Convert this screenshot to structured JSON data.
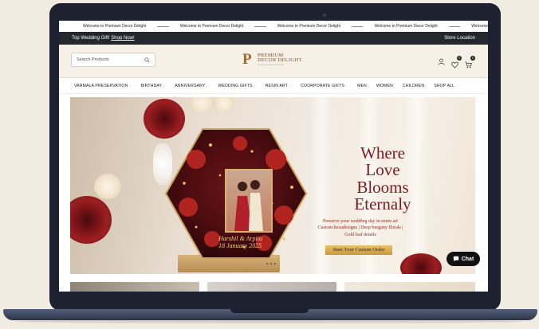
{
  "announcement": {
    "items": [
      "Welcome to Premium Decor Delight",
      "Welcome to Premium Decor Delight",
      "Welcome to Premium Decor Delight",
      "Welcome to Premium Decor Delight",
      "Welcome"
    ]
  },
  "topbar": {
    "promo_text": "Top Wedding Gift!",
    "promo_link": "Shop Now!",
    "store_location": "Store Location"
  },
  "header": {
    "search_placeholder": "Search Products",
    "logo_line1": "PREMIUM",
    "logo_line2": "DECOR DELIGHT",
    "logo_tagline": "Let The Love Blossom This Day",
    "wishlist_count": "0",
    "cart_count": "0"
  },
  "nav": {
    "items": [
      {
        "label": "VARMALA PRESERVATION",
        "dropdown": true
      },
      {
        "label": "BIRTHDAY",
        "dropdown": true
      },
      {
        "label": "ANNIVERSARY",
        "dropdown": true
      },
      {
        "label": "WEDDING GIFTS",
        "dropdown": true
      },
      {
        "label": "RESIN ART",
        "dropdown": true
      },
      {
        "label": "COORPORATE GIFTS",
        "dropdown": true
      },
      {
        "label": "MEN",
        "dropdown": false
      },
      {
        "label": "WOMEN",
        "dropdown": false
      },
      {
        "label": "CHILDREN",
        "dropdown": false
      },
      {
        "label": "SHOP ALL",
        "dropdown": false
      }
    ]
  },
  "hero": {
    "headline_1": "Where",
    "headline_2": "Love",
    "headline_3": "Blooms",
    "headline_4": "Eternaly",
    "sub_1": "Preserve your wedding day in stunn art",
    "sub_2": "Custom hexadesigns | Deep burgany florals |",
    "sub_3": "Gold leaf details",
    "cta": "Start Your Custom Order",
    "couple_names": "Harshil & Arpita",
    "couple_date": "18 January 2025"
  },
  "chat": {
    "label": "Chat"
  },
  "colors": {
    "accent": "#7a1c22",
    "gold": "#d4a94c",
    "dark_bar": "#24272e",
    "header_bg": "#f6f0e7"
  }
}
